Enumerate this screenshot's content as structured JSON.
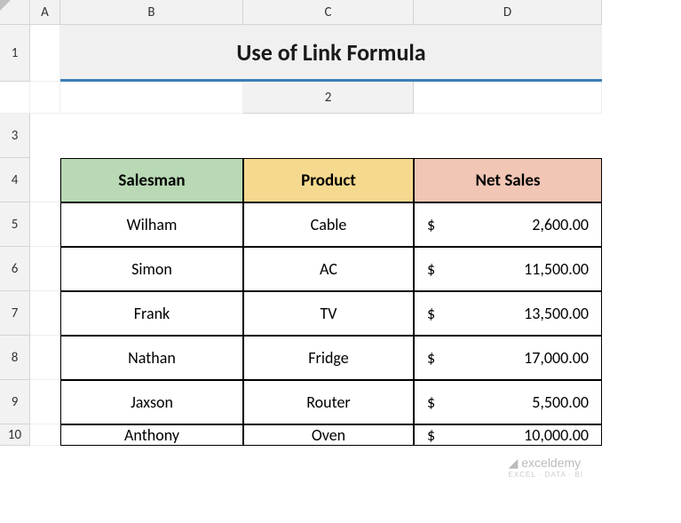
{
  "columns": [
    "A",
    "B",
    "C",
    "D"
  ],
  "rows": [
    "1",
    "2",
    "3",
    "4",
    "5",
    "6",
    "7",
    "8",
    "9",
    "10"
  ],
  "title": "Use of Link Formula",
  "headers": {
    "salesman": "Salesman",
    "product": "Product",
    "netsales": "Net Sales"
  },
  "data": [
    {
      "salesman": "Wilham",
      "product": "Cable",
      "sales": "2,600.00"
    },
    {
      "salesman": "Simon",
      "product": "AC",
      "sales": "11,500.00"
    },
    {
      "salesman": "Frank",
      "product": "TV",
      "sales": "13,500.00"
    },
    {
      "salesman": "Nathan",
      "product": "Fridge",
      "sales": "17,000.00"
    },
    {
      "salesman": "Jaxson",
      "product": "Router",
      "sales": "5,500.00"
    },
    {
      "salesman": "Anthony",
      "product": "Oven",
      "sales": "10,000.00"
    }
  ],
  "currency": "$",
  "watermark": {
    "main": "exceldemy",
    "sub": "EXCEL · DATA · BI"
  },
  "chart_data": {
    "type": "table",
    "title": "Use of Link Formula",
    "columns": [
      "Salesman",
      "Product",
      "Net Sales"
    ],
    "rows": [
      [
        "Wilham",
        "Cable",
        2600.0
      ],
      [
        "Simon",
        "AC",
        11500.0
      ],
      [
        "Frank",
        "TV",
        13500.0
      ],
      [
        "Nathan",
        "Fridge",
        17000.0
      ],
      [
        "Jaxson",
        "Router",
        5500.0
      ],
      [
        "Anthony",
        "Oven",
        10000.0
      ]
    ]
  }
}
